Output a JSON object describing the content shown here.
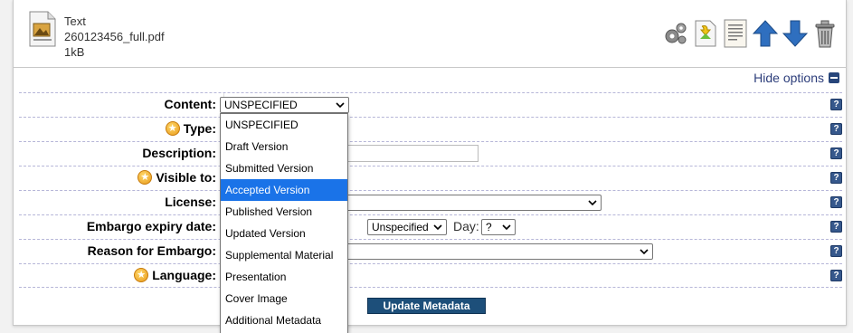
{
  "file": {
    "type": "Text",
    "name": "260123456_full.pdf",
    "size": "1kB"
  },
  "toolbar": {
    "icons": [
      "gears-icon",
      "convert-icon",
      "document-list-icon",
      "move-up-icon",
      "move-down-icon",
      "trash-icon"
    ]
  },
  "options_toggle": "Hide options",
  "fields": {
    "content": {
      "label": "Content:",
      "value": "UNSPECIFIED"
    },
    "type": {
      "label": "Type:"
    },
    "description": {
      "label": "Description:"
    },
    "visible_to": {
      "label": "Visible to:"
    },
    "license": {
      "label": "License:"
    },
    "embargo": {
      "label": "Embargo expiry date:",
      "month_value": "Unspecified",
      "day_label": "Day:",
      "day_value": "?"
    },
    "reason": {
      "label": "Reason for Embargo:"
    },
    "language": {
      "label": "Language:"
    }
  },
  "content_options": [
    "UNSPECIFIED",
    "Draft Version",
    "Submitted Version",
    "Accepted Version",
    "Published Version",
    "Updated Version",
    "Supplemental Material",
    "Presentation",
    "Cover Image",
    "Additional Metadata"
  ],
  "highlighted_option": "Accepted Version",
  "help_label": "?",
  "update_button": "Update Metadata",
  "colors": {
    "link": "#2c3d7a",
    "button": "#1d4f7a",
    "highlight": "#1a73e8",
    "help": "#36588c"
  }
}
